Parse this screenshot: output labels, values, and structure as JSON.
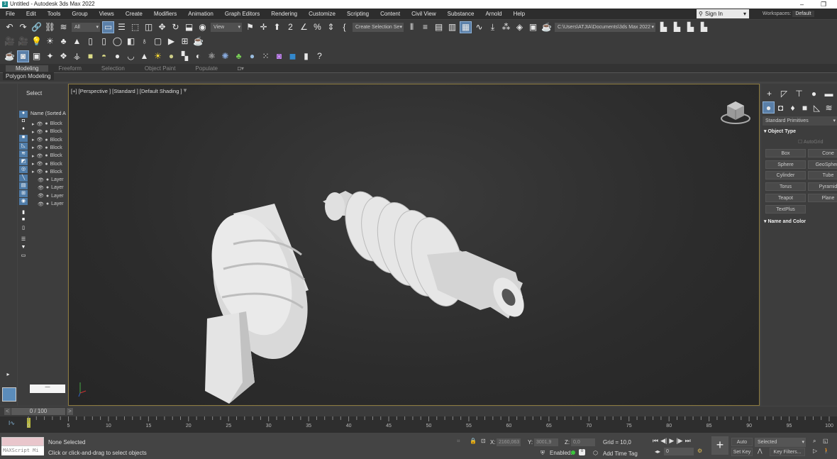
{
  "window": {
    "title": "Untitled - Autodesk 3ds Max 2022",
    "minimize": "–",
    "restore": "❐"
  },
  "menu": [
    "File",
    "Edit",
    "Tools",
    "Group",
    "Views",
    "Create",
    "Modifiers",
    "Animation",
    "Graph Editors",
    "Rendering",
    "Customize",
    "Scripting",
    "Content",
    "Civil View",
    "Substance",
    "Arnold",
    "Help"
  ],
  "account": {
    "sign_in": "Sign In",
    "workspaces_label": "Workspaces:",
    "workspace": "Default"
  },
  "toolbar": {
    "selection_filter": "All",
    "ref_coord": "View",
    "named_selection": "Create Selection Se",
    "project_path": "C:\\Users\\ATJIA\\Documents\\3ds Max 2022"
  },
  "ribbon": {
    "tabs": [
      "Modeling",
      "Freeform",
      "Selection",
      "Object Paint",
      "Populate"
    ],
    "active": "Modeling",
    "panel": "Polygon Modeling"
  },
  "explorer": {
    "title": "Select",
    "column": "Name (Sorted A",
    "items": [
      "Block",
      "Block",
      "Block",
      "Block",
      "Block",
      "Block",
      "Block",
      "Layer",
      "Layer",
      "Layer",
      "Layer"
    ]
  },
  "viewport": {
    "label": "[+] [Perspective ] [Standard ] [Default Shading ]"
  },
  "command_panel": {
    "category": "Standard Primitives",
    "object_type": "Object Type",
    "autogrid": "AutoGrid",
    "buttons": [
      "Box",
      "Cone",
      "Sphere",
      "GeoSphere",
      "Cylinder",
      "Tube",
      "Torus",
      "Pyramid",
      "Teapot",
      "Plane",
      "TextPlus"
    ],
    "name_color": "Name and Color"
  },
  "timeline": {
    "frame": "0 / 100",
    "ticks": [
      "0",
      "5",
      "10",
      "15",
      "20",
      "25",
      "30",
      "35",
      "40",
      "45",
      "50",
      "55",
      "60",
      "65",
      "70",
      "75",
      "80",
      "85",
      "90",
      "95",
      "100"
    ]
  },
  "status": {
    "selection": "None Selected",
    "prompt": "Click or click-and-drag to select objects",
    "maxscript": "MAXScript Mi",
    "x_label": "X:",
    "x": "2160,063",
    "y_label": "Y:",
    "y": "3001,9",
    "z_label": "Z:",
    "z": "0,0",
    "grid": "Grid = 10,0",
    "enabled": "Enabled:",
    "add_time_tag": "Add Time Tag",
    "current_frame": "0",
    "auto_key": "Auto Key",
    "set_key": "Set Key",
    "key_mode": "Selected",
    "key_filters": "Key Filters..."
  },
  "colors": {
    "viewport_border": "#8c7a3e",
    "active_tool": "#5a7fa8",
    "enabled_dot": "#3cc43c"
  }
}
